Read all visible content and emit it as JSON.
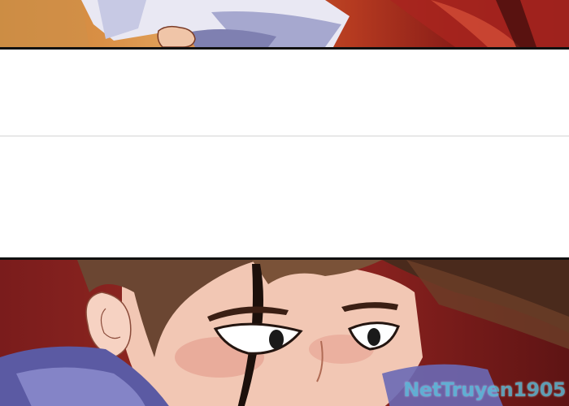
{
  "watermark": {
    "text": "NetTruyen1905",
    "color": "#5ec4e0"
  },
  "panels": [
    {
      "name": "top-panel",
      "subject": "robed-figure-fragment"
    },
    {
      "name": "gutter",
      "subject": "blank-white"
    },
    {
      "name": "bottom-panel",
      "subject": "long-haired-man-close-up"
    }
  ]
}
